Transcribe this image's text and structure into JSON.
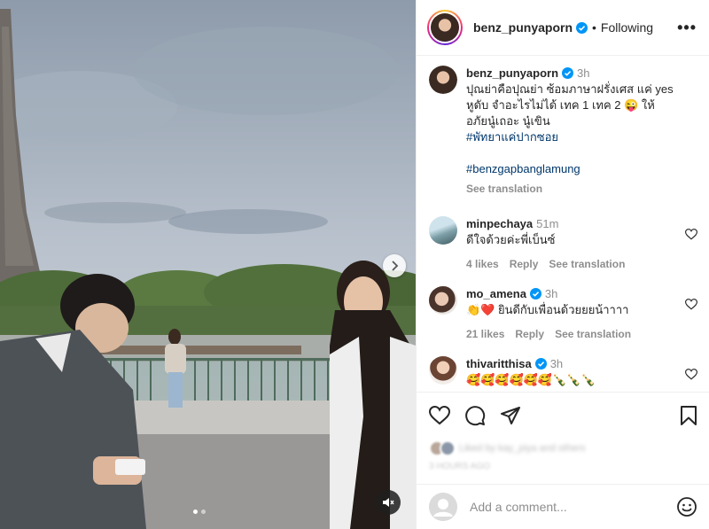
{
  "post": {
    "username": "benz_punyaporn",
    "follow_state": "Following",
    "separator": "•",
    "more_label": "•••"
  },
  "caption": {
    "username": "benz_punyaporn",
    "time": "3h",
    "text": "ปุณย่าคือปุณย่า ซ้อมภาษาฝรั่งเศส แค่ yes หูดับ จำอะไรไม่ได้ เทค 1 เทค 2 😜 ให้อภัยนู๋เถอะ นู๋เขิน",
    "hashtag_1": "#พัทยาแค่ปากซอย",
    "hashtag_2": "#benzgapbanglamung",
    "see_translation": "See translation"
  },
  "comments": [
    {
      "username": "minpechaya",
      "time": "51m",
      "text": "ดีใจด้วยค่ะพี่เบ็นซ์",
      "likes": "4 likes",
      "reply": "Reply",
      "see_translation": "See translation"
    },
    {
      "username": "mo_amena",
      "time": "3h",
      "text": "👏❤️ ยินดีกับเพื่อนด้วยยยน้าาาา",
      "likes": "21 likes",
      "reply": "Reply",
      "see_translation": "See translation"
    },
    {
      "username": "thivaritthisa",
      "time": "3h",
      "text": "🥰🥰🥰🥰🥰🥰🍾🍾🍾"
    }
  ],
  "liked_by": {
    "text": "Liked by kay_piya and others",
    "date": "3 HOURS AGO"
  },
  "add_comment": {
    "placeholder": "Add a comment..."
  },
  "colors": {
    "link": "#00376b",
    "verified": "#0095f6",
    "muted": "#8e8e8e"
  }
}
